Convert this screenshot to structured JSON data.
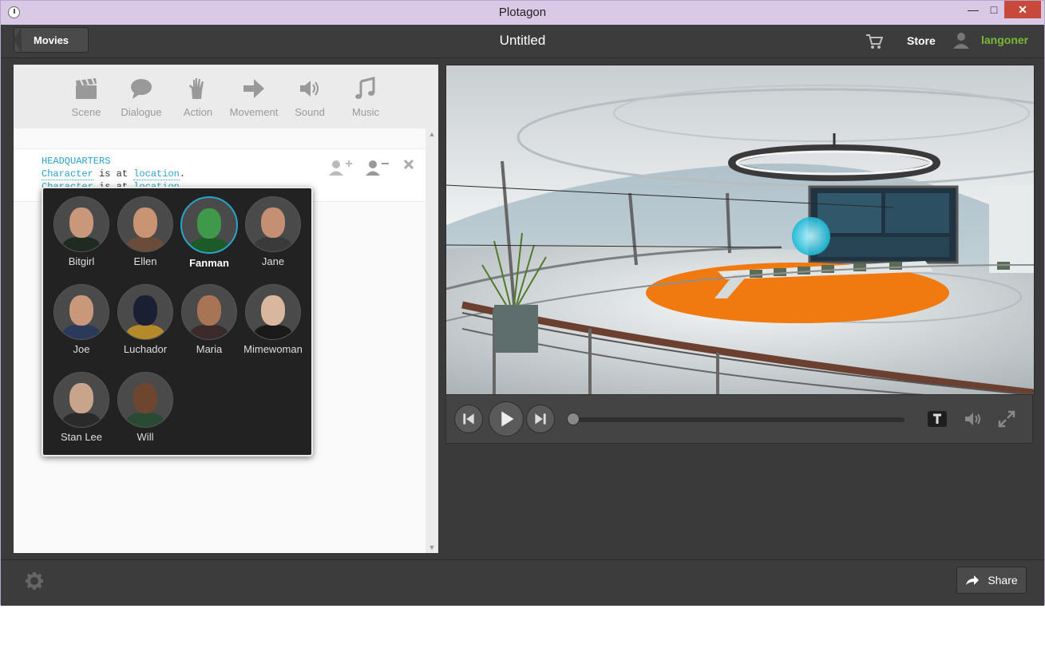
{
  "window": {
    "title": "Plotagon"
  },
  "header": {
    "back_label": "Movies",
    "doc_title": "Untitled",
    "store_label": "Store",
    "username": "langoner"
  },
  "toolbar": {
    "items": [
      {
        "label": "Scene",
        "icon": "clapperboard-icon"
      },
      {
        "label": "Dialogue",
        "icon": "speech-bubble-icon"
      },
      {
        "label": "Action",
        "icon": "hand-icon"
      },
      {
        "label": "Movement",
        "icon": "arrow-right-icon"
      },
      {
        "label": "Sound",
        "icon": "speaker-icon"
      },
      {
        "label": "Music",
        "icon": "music-note-icon"
      }
    ]
  },
  "script": {
    "location_header": "HEADQUARTERS",
    "line1": {
      "character": "Character",
      "text": " is at ",
      "location": "location",
      "end": "."
    },
    "line2": {
      "character": "Character",
      "text": " is at ",
      "location": "location",
      "end": ""
    }
  },
  "character_picker": {
    "selected": "Fanman",
    "characters": [
      {
        "name": "Bitgirl",
        "skin": "#c9977a",
        "shirt": "#1f2a20"
      },
      {
        "name": "Ellen",
        "skin": "#c89474",
        "shirt": "#6b4b3a"
      },
      {
        "name": "Fanman",
        "skin": "#3e9a4a",
        "shirt": "#1c5a28"
      },
      {
        "name": "Jane",
        "skin": "#c48f73",
        "shirt": "#3a3a3a"
      },
      {
        "name": "Joe",
        "skin": "#c9977a",
        "shirt": "#2a3a5a"
      },
      {
        "name": "Luchador",
        "skin": "#1a1f33",
        "shirt": "#b58a2a"
      },
      {
        "name": "Maria",
        "skin": "#a87456",
        "shirt": "#3a2a2a"
      },
      {
        "name": "Mimewoman",
        "skin": "#d8b79e",
        "shirt": "#1a1a1a"
      },
      {
        "name": "Stan Lee",
        "skin": "#c9a48c",
        "shirt": "#2a2a2a"
      },
      {
        "name": "Will",
        "skin": "#6e4630",
        "shirt": "#2b4a33"
      }
    ]
  },
  "footer": {
    "share_label": "Share"
  },
  "colors": {
    "accent": "#2aa3c9",
    "username": "#7bb83a",
    "close_button": "#c7493b"
  }
}
